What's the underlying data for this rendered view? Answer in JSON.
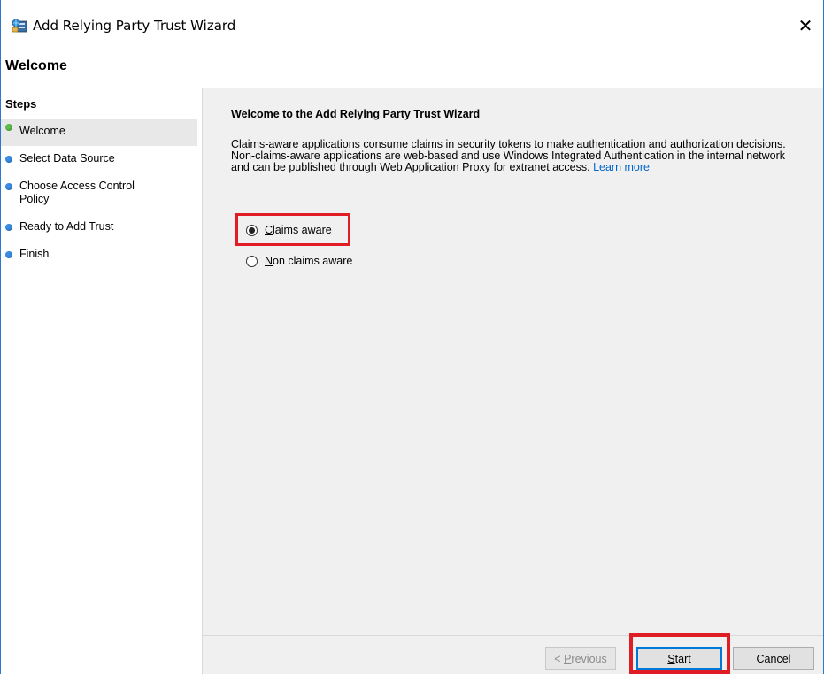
{
  "window": {
    "title": "Add Relying Party Trust Wizard",
    "close_glyph": "✕"
  },
  "header": {
    "title": "Welcome"
  },
  "steps": {
    "title": "Steps",
    "items": [
      {
        "label": "Welcome",
        "status": "current",
        "color": "#5cc04a"
      },
      {
        "label": "Select Data Source",
        "status": "pending",
        "color": "#3a8ee6"
      },
      {
        "label": "Choose Access Control Policy",
        "status": "pending",
        "color": "#3a8ee6"
      },
      {
        "label": "Ready to Add Trust",
        "status": "pending",
        "color": "#3a8ee6"
      },
      {
        "label": "Finish",
        "status": "pending",
        "color": "#3a8ee6"
      }
    ]
  },
  "content": {
    "title": "Welcome to the Add Relying Party Trust Wizard",
    "description": "Claims-aware applications consume claims in security tokens to make authentication and authorization decisions. Non-claims-aware applications are web-based and use Windows Integrated Authentication in the internal network and can be published through Web Application Proxy for extranet access.",
    "learn_more": "Learn more",
    "options": [
      {
        "accel": "C",
        "rest": "laims aware",
        "selected": true
      },
      {
        "accel": "N",
        "rest": "on claims aware",
        "selected": false
      }
    ]
  },
  "footer": {
    "previous_prefix": "< ",
    "previous_accel": "P",
    "previous_rest": "revious",
    "start_accel": "S",
    "start_rest": "tart",
    "cancel": "Cancel"
  },
  "colors": {
    "highlight": "#e01d25",
    "link": "#0066cc",
    "accent": "#0078d7"
  }
}
